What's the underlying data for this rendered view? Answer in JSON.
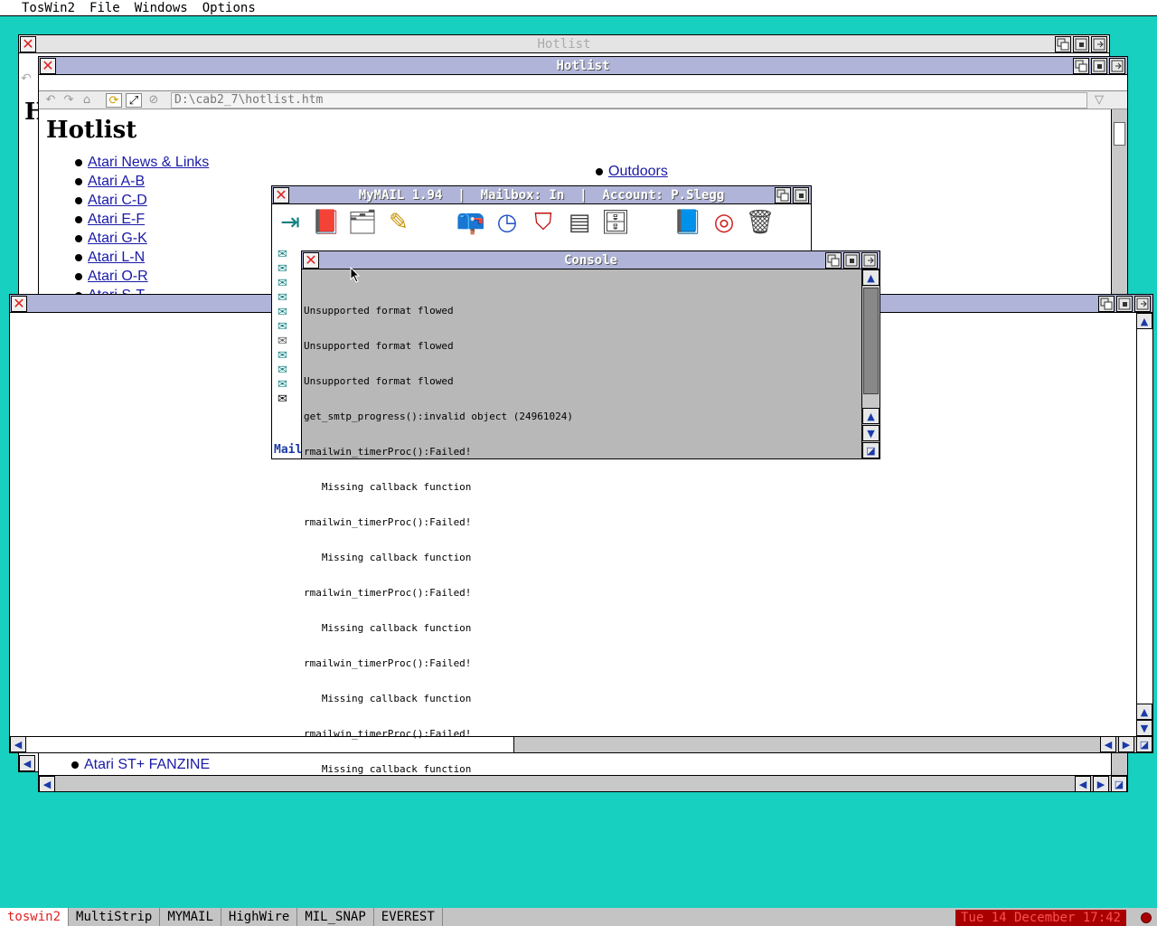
{
  "menubar": {
    "items": [
      "TosWin2",
      "File",
      "Windows",
      "Options"
    ]
  },
  "hotlist_back": {
    "title": "Hotlist"
  },
  "hotlist": {
    "title": "Hotlist",
    "url": "D:\\cab2_7\\hotlist.htm",
    "heading": "Hotlist",
    "links_left": [
      "Atari News & Links",
      "Atari A-B",
      "Atari C-D",
      "Atari E-F",
      "Atari G-K",
      "Atari L-N",
      "Atari O-R",
      "Atari S-T"
    ],
    "links_right": [
      "Outdoors"
    ],
    "bottom_link": "Atari ST+ FANZINE"
  },
  "mymail": {
    "title": "MyMAIL 1.94  |  Mailbox: In  |  Account: P.Slegg",
    "status_fragment": "Mail"
  },
  "console": {
    "title": "Console",
    "lines": [
      "Unsupported format flowed",
      "Unsupported format flowed",
      "Unsupported format flowed",
      "get_smtp_progress():invalid object (24961024)",
      "rmailwin_timerProc():Failed!",
      "   Missing callback function",
      "rmailwin_timerProc():Failed!",
      "   Missing callback function",
      "rmailwin_timerProc():Failed!",
      "   Missing callback function",
      "rmailwin_timerProc():Failed!",
      "   Missing callback function",
      "rmailwin_timerProc():Failed!",
      "   Missing callback function"
    ]
  },
  "taskbar": {
    "tasks": [
      "toswin2",
      "MultiStrip",
      "MYMAIL",
      "HighWire",
      "MIL_SNAP",
      "EVEREST"
    ],
    "clock": "Tue 14 December 17:42"
  },
  "colors": {
    "desktop": "#17d0bf",
    "title_active": "#b0b4d8",
    "link": "#1a1aa8",
    "clock_bg": "#a80000"
  },
  "icons": [
    "close-icon",
    "iconify-icon",
    "fuller-icon",
    "backdrop-icon",
    "arrow-up-icon",
    "arrow-down-icon",
    "arrow-left-icon",
    "arrow-right-icon",
    "size-grip-icon",
    "mailbox-icon",
    "trash-icon",
    "help-book-icon",
    "lifebuoy-icon"
  ]
}
